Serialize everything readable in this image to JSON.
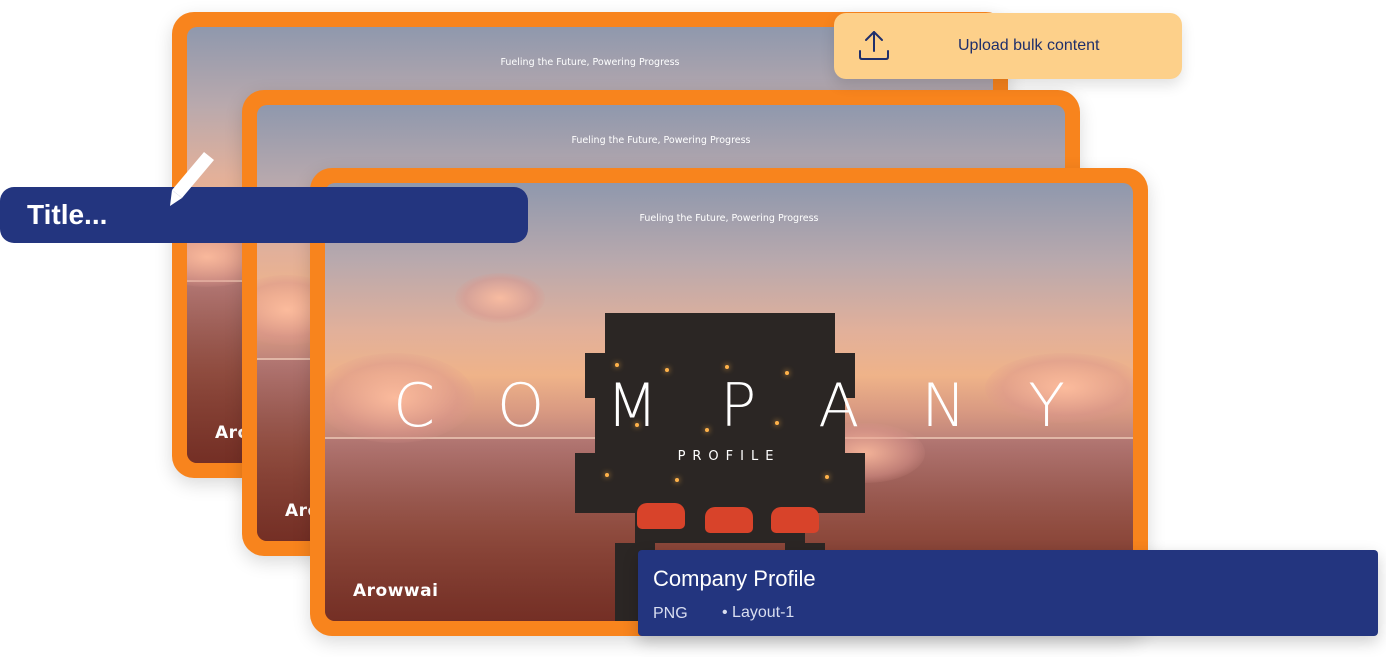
{
  "slides": [
    {
      "tagline": "Fueling the Future, Powering Progress",
      "brand": "Arowwai"
    },
    {
      "tagline": "Fueling the Future, Powering Progress",
      "brand": "Arowwai"
    },
    {
      "tagline": "Fueling the Future, Powering Progress",
      "brand": "Arowwai",
      "headline_letters": [
        "C",
        "O",
        "M",
        "P",
        "A",
        "N",
        "Y"
      ],
      "subheadline": "PROFILE"
    }
  ],
  "upload": {
    "label": "Upload bulk content",
    "icon": "upload-icon"
  },
  "title_input": {
    "value": "Title...",
    "icon": "pencil-icon"
  },
  "info": {
    "title": "Company Profile",
    "type": "PNG",
    "layout": "• Layout-1"
  },
  "colors": {
    "accent_orange": "#f8841d",
    "navy": "#23357f",
    "upload_bg": "#fdd08a"
  }
}
